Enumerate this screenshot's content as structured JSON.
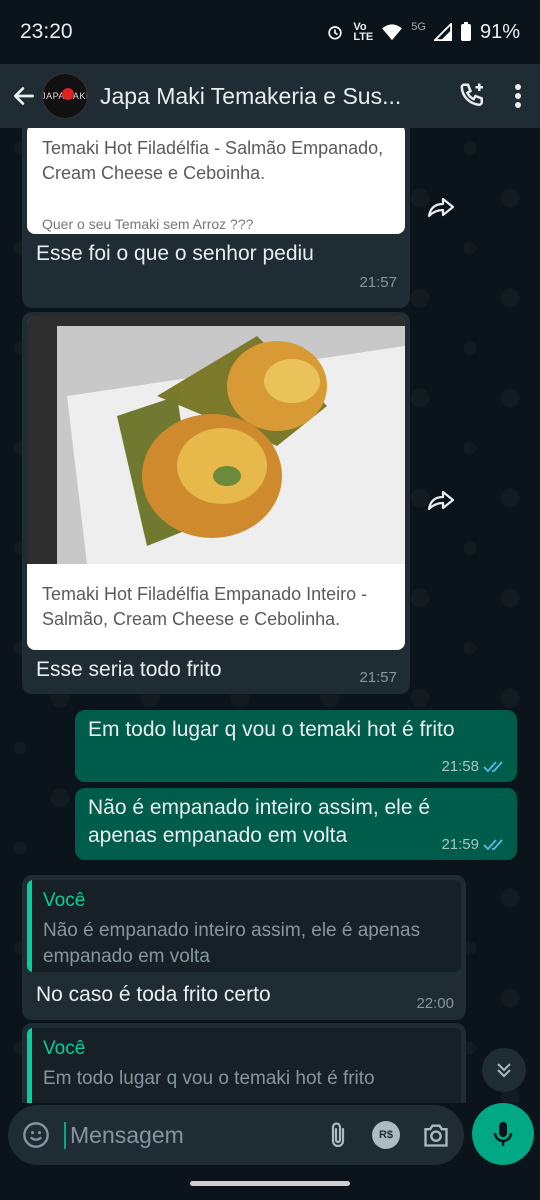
{
  "status": {
    "time": "23:20",
    "battery": "91%",
    "network": "5G"
  },
  "header": {
    "title": "Japa Maki Temakeria e Sus...",
    "avatar_text": "JAPAMAKI"
  },
  "messages": {
    "m1": {
      "preview_text": "Temaki Hot Filadélfia - Salmão Empanado, Cream Cheese e Ceboinha.",
      "preview_extra": "Quer o seu Temaki sem Arroz ???",
      "text": "Esse foi o que o senhor pediu",
      "time": "21:57"
    },
    "m2": {
      "preview_text": "Temaki Hot Filadélfia Empanado Inteiro - Salmão, Cream Cheese e Cebolinha.",
      "text": "Esse seria todo frito",
      "time": "21:57"
    },
    "m3": {
      "text": "Em todo lugar q vou o temaki hot é frito",
      "time": "21:58"
    },
    "m4": {
      "text": "Não é empanado inteiro assim, ele é apenas empanado em volta",
      "time": "21:59"
    },
    "m5": {
      "quote_author": "Você",
      "quote_text": "Não é empanado inteiro assim, ele é apenas empanado em volta",
      "text": "No caso é toda frito certo",
      "time": "22:00"
    },
    "m6": {
      "quote_author": "Você",
      "quote_text": "Em todo lugar q vou o temaki hot é frito"
    }
  },
  "input": {
    "placeholder": "Mensagem"
  },
  "colors": {
    "accent": "#00a884",
    "bubble_out": "#005c4b",
    "bubble_in": "#1f2c34",
    "ticks": "#53bdeb"
  },
  "icons": [
    "back-icon",
    "add-call-icon",
    "more-vert-icon",
    "forward-icon",
    "emoji-icon",
    "attach-icon",
    "pix-icon",
    "camera-icon",
    "mic-icon",
    "chevron-double-down-icon"
  ]
}
